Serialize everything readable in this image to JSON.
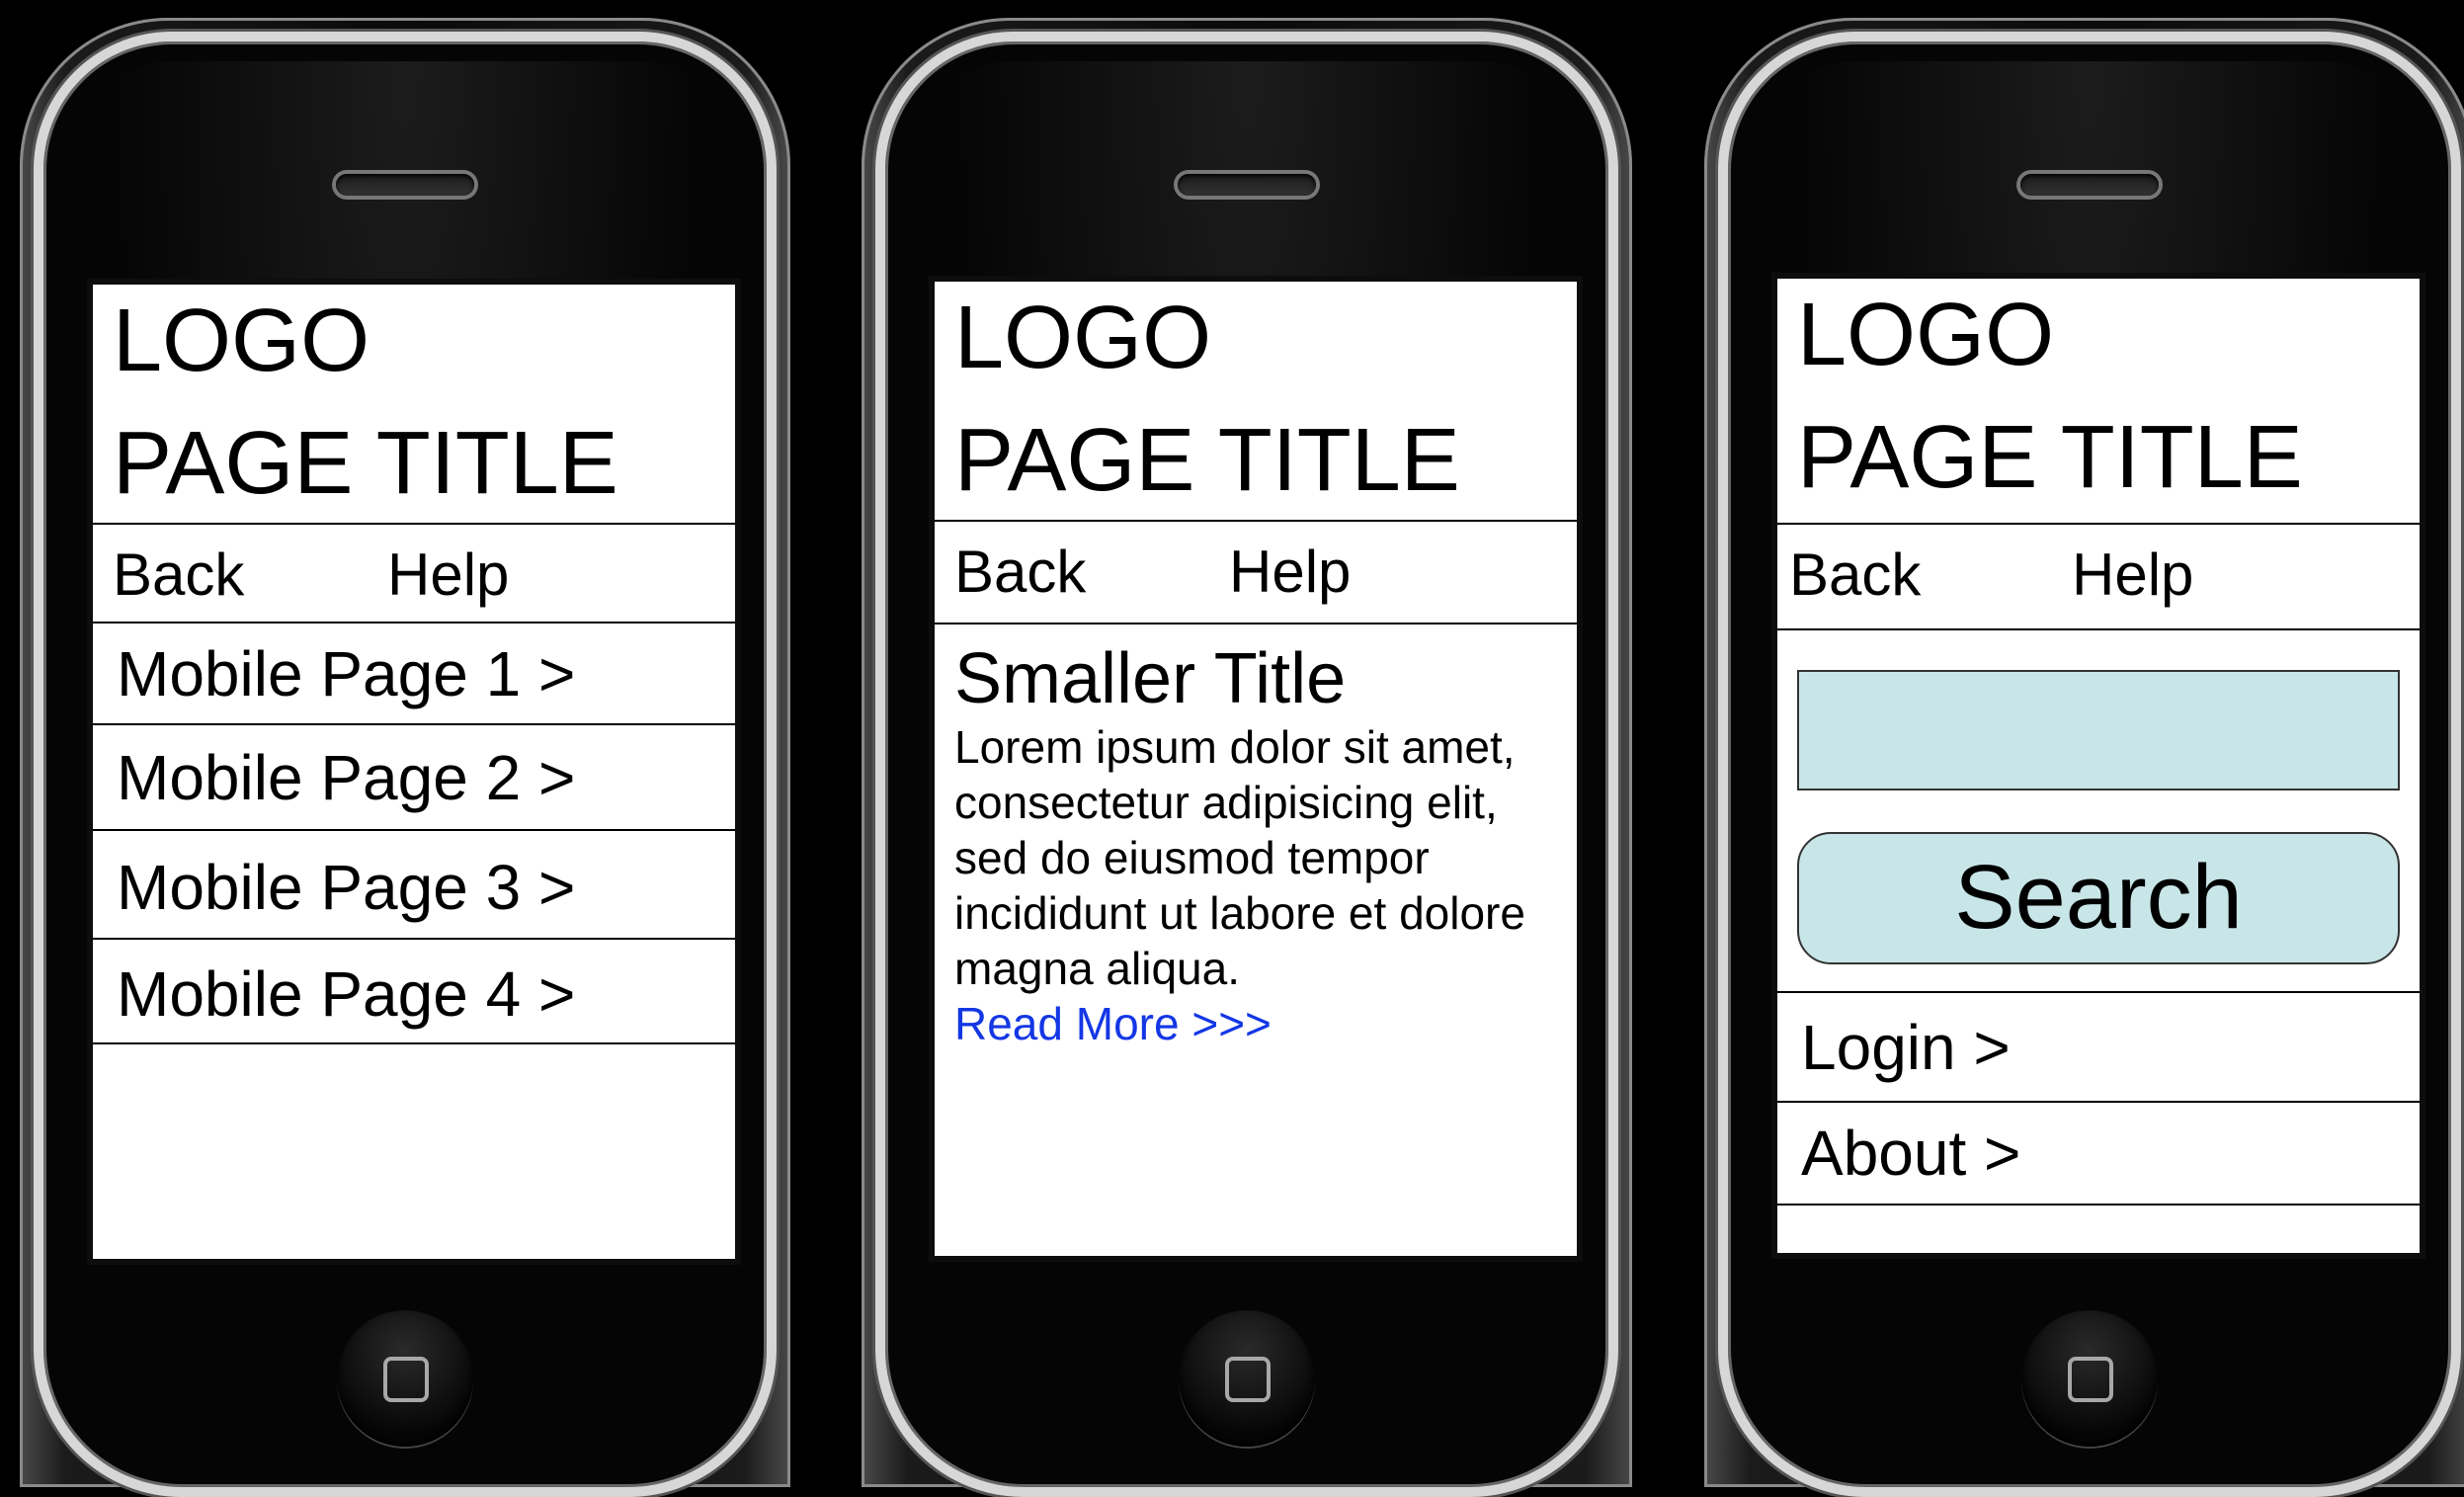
{
  "phones": [
    {
      "header": {
        "logo": "LOGO",
        "title": "PAGE TITLE"
      },
      "nav": {
        "back": "Back",
        "help": "Help"
      },
      "menu": [
        {
          "label": "Mobile Page 1 >"
        },
        {
          "label": "Mobile Page 2 >"
        },
        {
          "label": "Mobile Page 3 >"
        },
        {
          "label": "Mobile Page 4 >"
        }
      ]
    },
    {
      "header": {
        "logo": "LOGO",
        "title": "PAGE TITLE"
      },
      "nav": {
        "back": "Back",
        "help": "Help"
      },
      "content": {
        "title": "Smaller Title",
        "body": "Lorem ipsum dolor sit amet, consectetur adipisicing elit, sed do eiusmod tempor incididunt ut labore et dolore magna aliqua.",
        "read_more": "Read More >>>"
      }
    },
    {
      "header": {
        "logo": "LOGO",
        "title": "PAGE TITLE"
      },
      "nav": {
        "back": "Back",
        "help": "Help"
      },
      "search": {
        "value": "",
        "button": "Search"
      },
      "links": [
        {
          "label": "Login >"
        },
        {
          "label": "About >"
        }
      ]
    }
  ],
  "colors": {
    "input_fill": "#c8e6e8",
    "link": "#1437e5",
    "background": "#000000"
  },
  "icons": [
    "home-button-icon",
    "speaker-grille-icon"
  ]
}
